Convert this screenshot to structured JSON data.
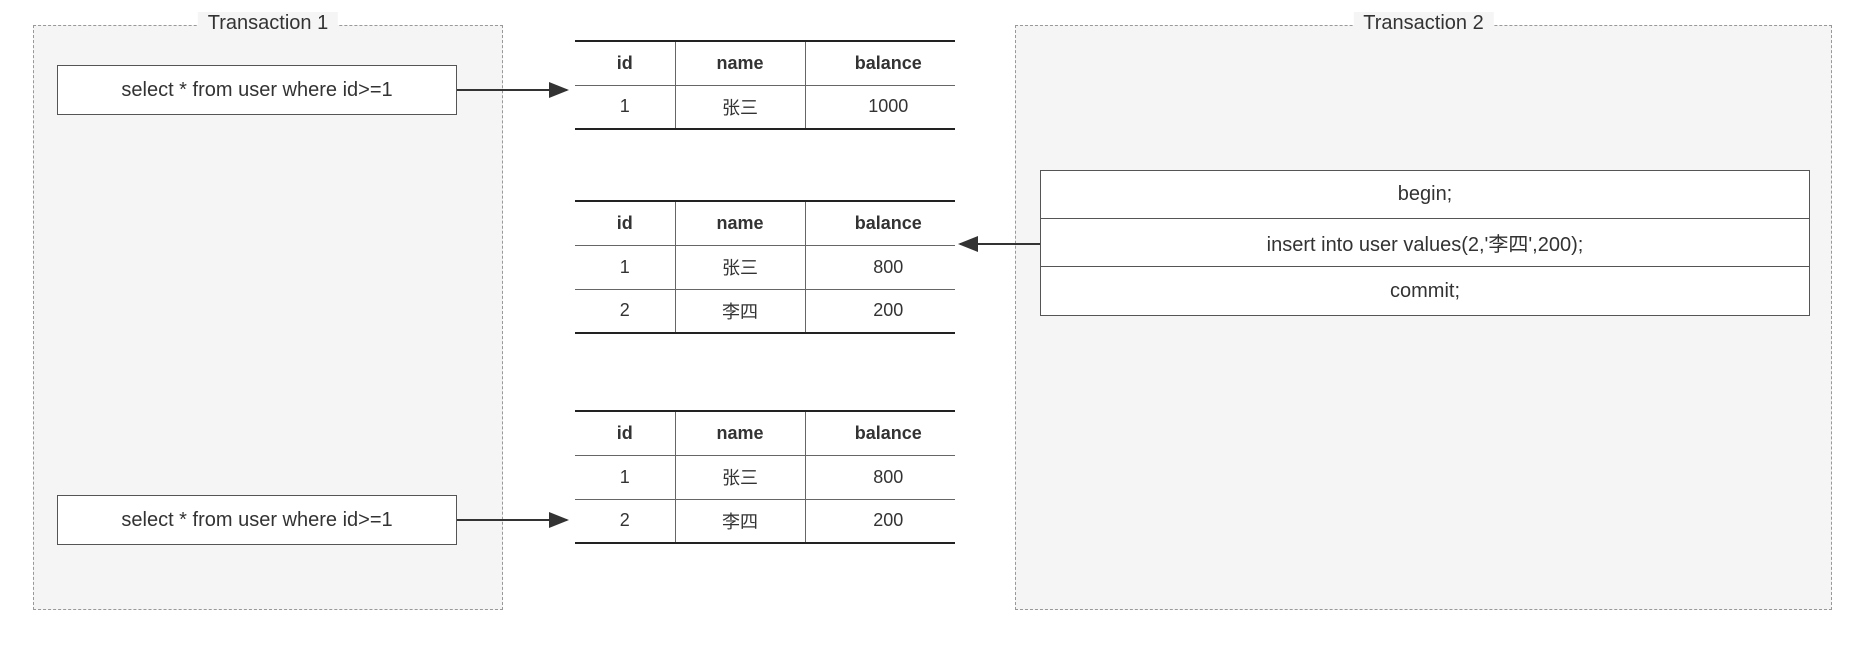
{
  "panels": {
    "left_title": "Transaction  1",
    "right_title": "Transaction  2"
  },
  "left_statements": {
    "s1": "select * from user where id>=1",
    "s2": "select * from user where id>=1"
  },
  "right_statements": {
    "r1": "begin;",
    "r2": "insert into user values(2,'李四',200);",
    "r3": "commit;"
  },
  "tables": {
    "t1": {
      "headers": {
        "id": "id",
        "name": "name",
        "balance": "balance"
      },
      "rows": [
        {
          "id": "1",
          "name": "张三",
          "balance": "1000"
        }
      ]
    },
    "t2": {
      "headers": {
        "id": "id",
        "name": "name",
        "balance": "balance"
      },
      "rows": [
        {
          "id": "1",
          "name": "张三",
          "balance": "800"
        },
        {
          "id": "2",
          "name": "李四",
          "balance": "200"
        }
      ]
    },
    "t3": {
      "headers": {
        "id": "id",
        "name": "name",
        "balance": "balance"
      },
      "rows": [
        {
          "id": "1",
          "name": "张三",
          "balance": "800"
        },
        {
          "id": "2",
          "name": "李四",
          "balance": "200"
        }
      ]
    }
  }
}
